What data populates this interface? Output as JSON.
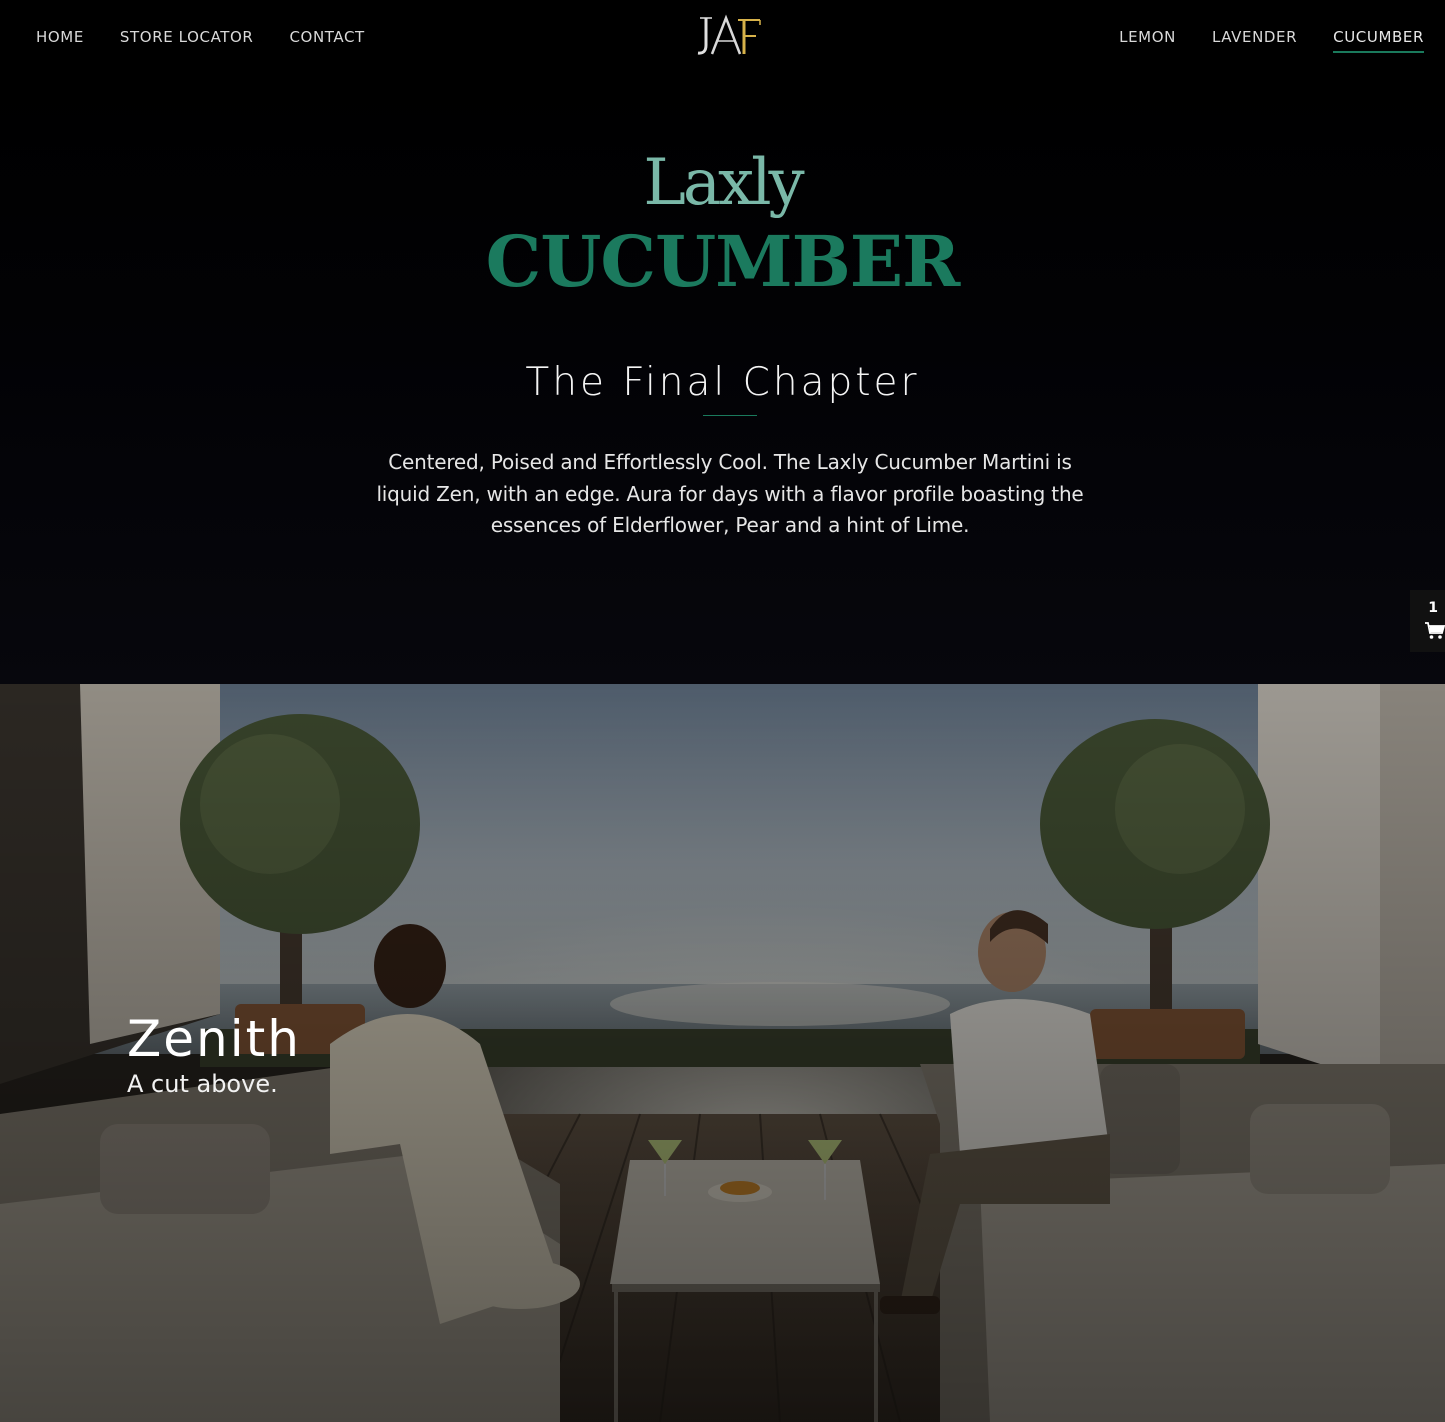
{
  "nav": {
    "left": [
      "HOME",
      "STORE LOCATOR",
      "CONTACT"
    ],
    "right": [
      "LEMON",
      "LAVENDER",
      "CUCUMBER"
    ],
    "active": "CUCUMBER",
    "logo_text": "JAF"
  },
  "hero": {
    "brand": "Laxly",
    "flavor": "CUCUMBER",
    "title": "The Final Chapter",
    "description": "Centered, Poised and Effortlessly Cool. The Laxly Cucumber Martini is liquid Zen, with an edge. Aura for days with a flavor profile boasting the essences of Elderflower, Pear and a hint of Lime."
  },
  "cart": {
    "count": "1",
    "icon": "shopping-cart-icon"
  },
  "feature": {
    "title": "Zenith",
    "subtitle": "A cut above."
  },
  "colors": {
    "accent": "#1a7a5c",
    "brand_light": "#7ab8a8",
    "background": "#000000"
  }
}
